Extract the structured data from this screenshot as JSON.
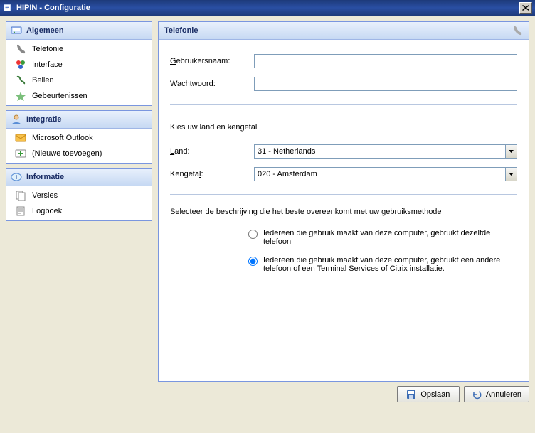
{
  "window": {
    "title": "HIPIN - Configuratie"
  },
  "sidebar": {
    "groups": [
      {
        "title": "Algemeen",
        "items": [
          "Telefonie",
          "Interface",
          "Bellen",
          "Gebeurtenissen"
        ]
      },
      {
        "title": "Integratie",
        "items": [
          "Microsoft Outlook",
          "(Nieuwe toevoegen)"
        ]
      },
      {
        "title": "Informatie",
        "items": [
          "Versies",
          "Logboek"
        ]
      }
    ]
  },
  "main": {
    "title": "Telefonie",
    "username_label": "Gebruikersnaam:",
    "password_label": "Wachtwoord:",
    "username_value": "",
    "password_value": "",
    "country_title": "Kies uw land en kengetal",
    "country_label": "Land:",
    "country_value": "31 - Netherlands",
    "areacode_label": "Kengetal:",
    "areacode_value": "020 - Amsterdam",
    "radio_title": "Selecteer de beschrijving die het beste overeenkomt met uw gebruiksmethode",
    "radio1": "Iedereen die gebruik maakt van deze computer, gebruikt dezelfde telefoon",
    "radio2": "Iedereen die gebruik maakt van deze computer, gebruikt een andere telefoon of een Terminal Services of Citrix installatie.",
    "radio_selected": 2
  },
  "buttons": {
    "save": "Opslaan",
    "cancel": "Annuleren"
  }
}
